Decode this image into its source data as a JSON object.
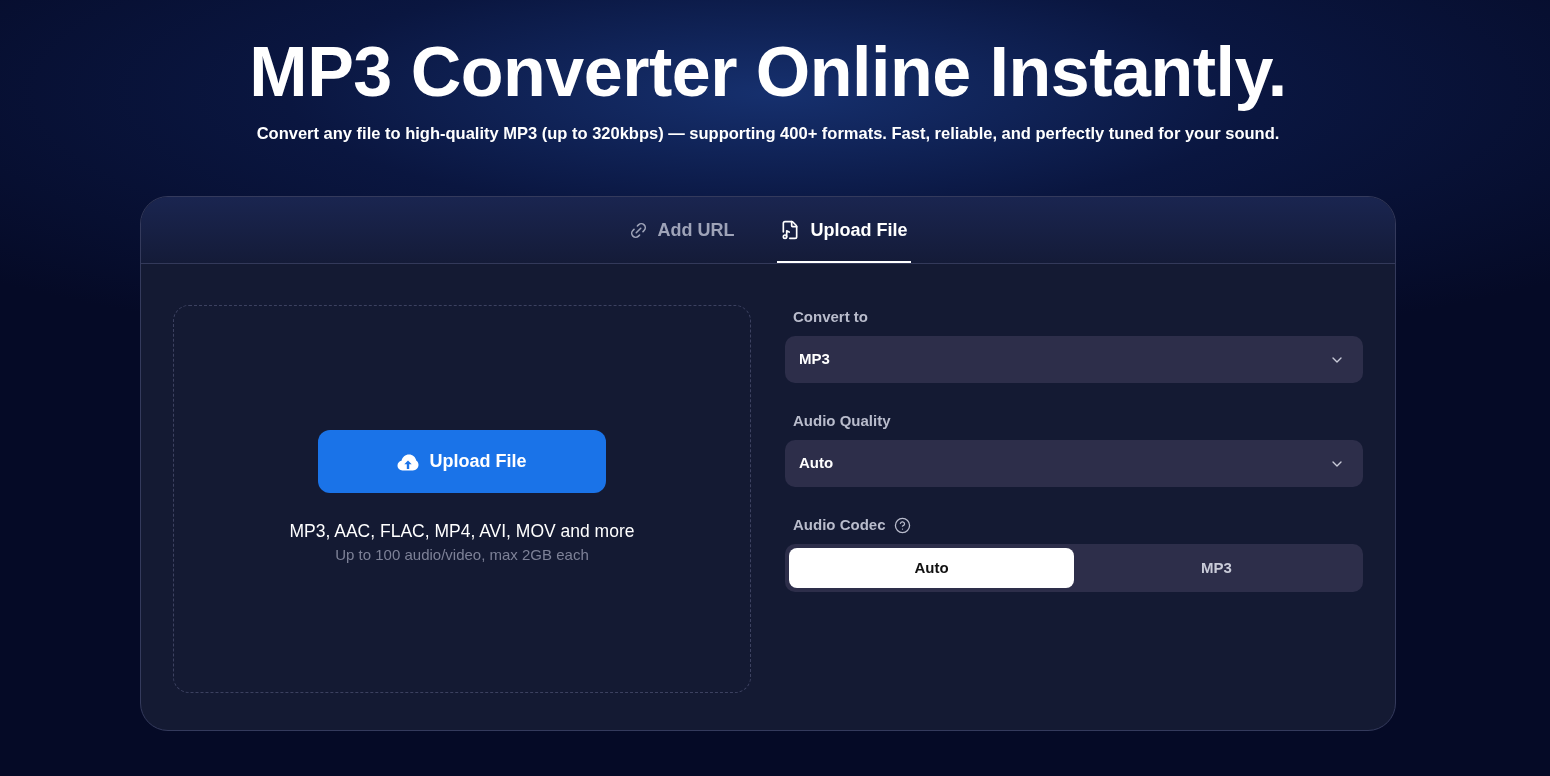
{
  "hero": {
    "title": "MP3 Converter Online Instantly.",
    "subtitle": "Convert any file to high-quality MP3 (up to 320kbps) — supporting 400+ formats. Fast, reliable, and perfectly tuned for your sound."
  },
  "converter": {
    "tabs": [
      {
        "label": "Add URL",
        "kind": "link",
        "selected": false
      },
      {
        "label": "Upload File",
        "kind": "file",
        "selected": true
      }
    ],
    "dropzone": {
      "button": "Upload File",
      "formats": "MP3, AAC, FLAC, MP4, AVI, MOV and more",
      "limits": "Up to 100 audio/video, max 2GB each"
    },
    "settings": [
      {
        "kind": "select",
        "label": "Convert to",
        "value": "MP3"
      },
      {
        "kind": "select",
        "label": "Audio Quality",
        "value": "Auto"
      },
      {
        "kind": "segmented",
        "label": "Audio Codec",
        "help": true,
        "options": [
          {
            "label": "Auto",
            "selected": true
          },
          {
            "label": "MP3",
            "selected": false
          }
        ]
      }
    ]
  }
}
